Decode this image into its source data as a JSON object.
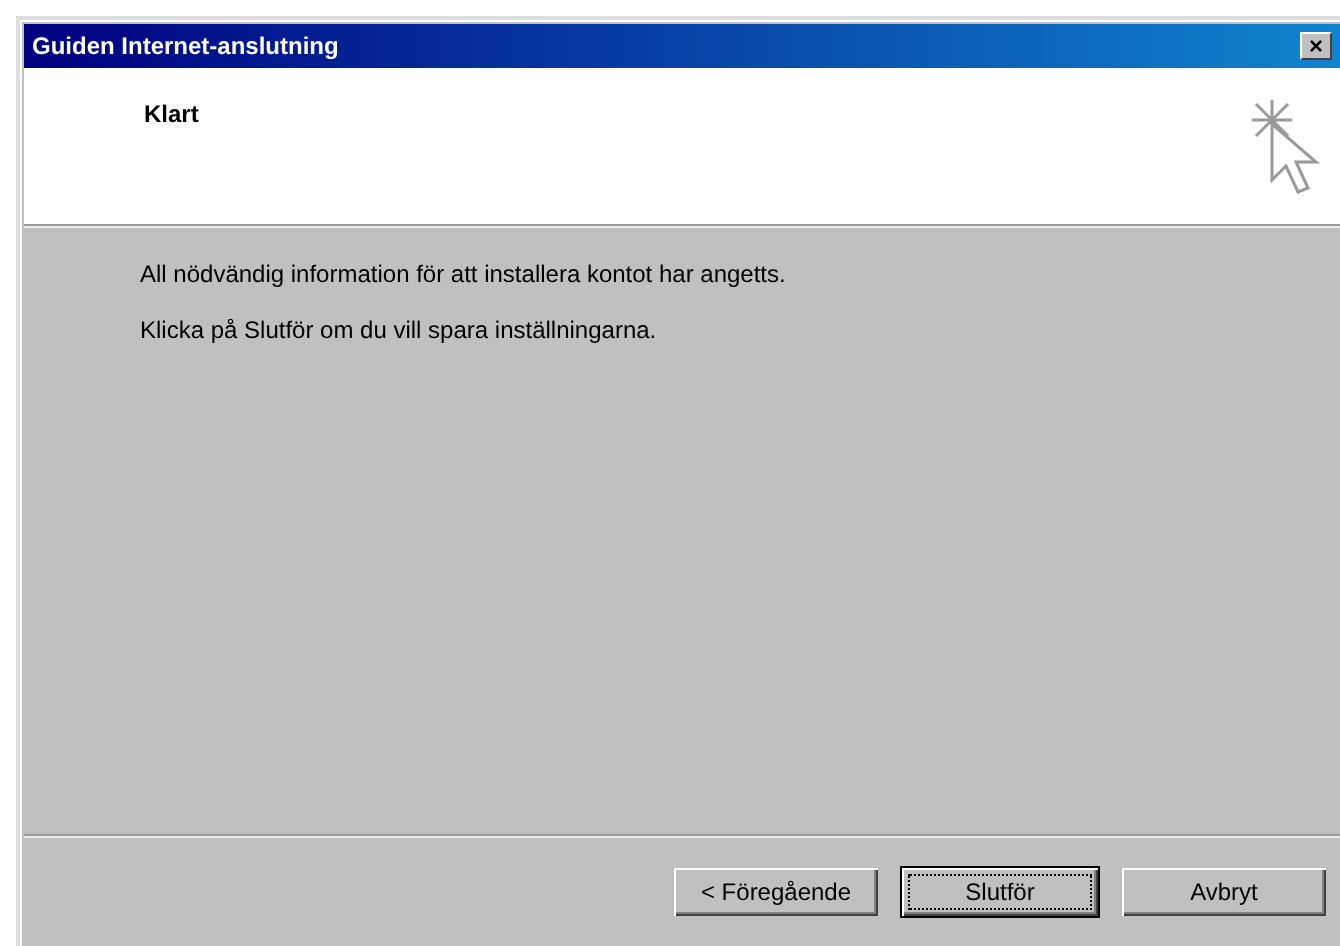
{
  "window": {
    "title": "Guiden Internet-anslutning",
    "close": "×"
  },
  "header": {
    "title": "Klart"
  },
  "body": {
    "lines": [
      "All nödvändig information för att installera kontot har angetts.",
      "Klicka på Slutför om du vill spara inställningarna."
    ]
  },
  "buttons": [
    {
      "label": "< Föregående",
      "default": false
    },
    {
      "label": "Slutför",
      "default": true
    },
    {
      "label": "Avbryt",
      "default": false
    }
  ]
}
